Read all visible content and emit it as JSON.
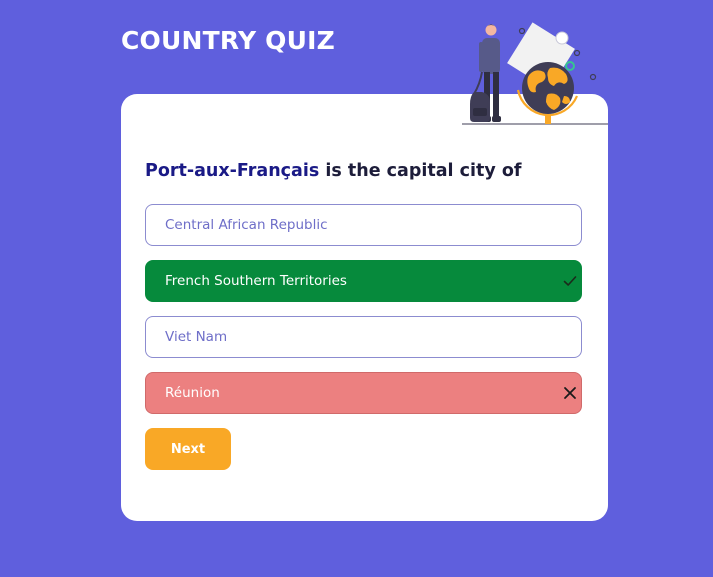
{
  "app": {
    "title": "COUNTRY QUIZ"
  },
  "question": {
    "city": "Port-aux-Français",
    "text": " is the capital city of"
  },
  "options": [
    {
      "label": "Central African Republic",
      "state": "default"
    },
    {
      "label": "French Southern Territories",
      "state": "correct",
      "icon": "check-icon"
    },
    {
      "label": "Viet Nam",
      "state": "default"
    },
    {
      "label": "Réunion",
      "state": "wrong",
      "icon": "cross-icon"
    }
  ],
  "actions": {
    "next_label": "Next"
  },
  "colors": {
    "background": "#5f5fdd",
    "correct": "#068a3c",
    "wrong": "#ec8080",
    "next_button": "#f9a826"
  }
}
